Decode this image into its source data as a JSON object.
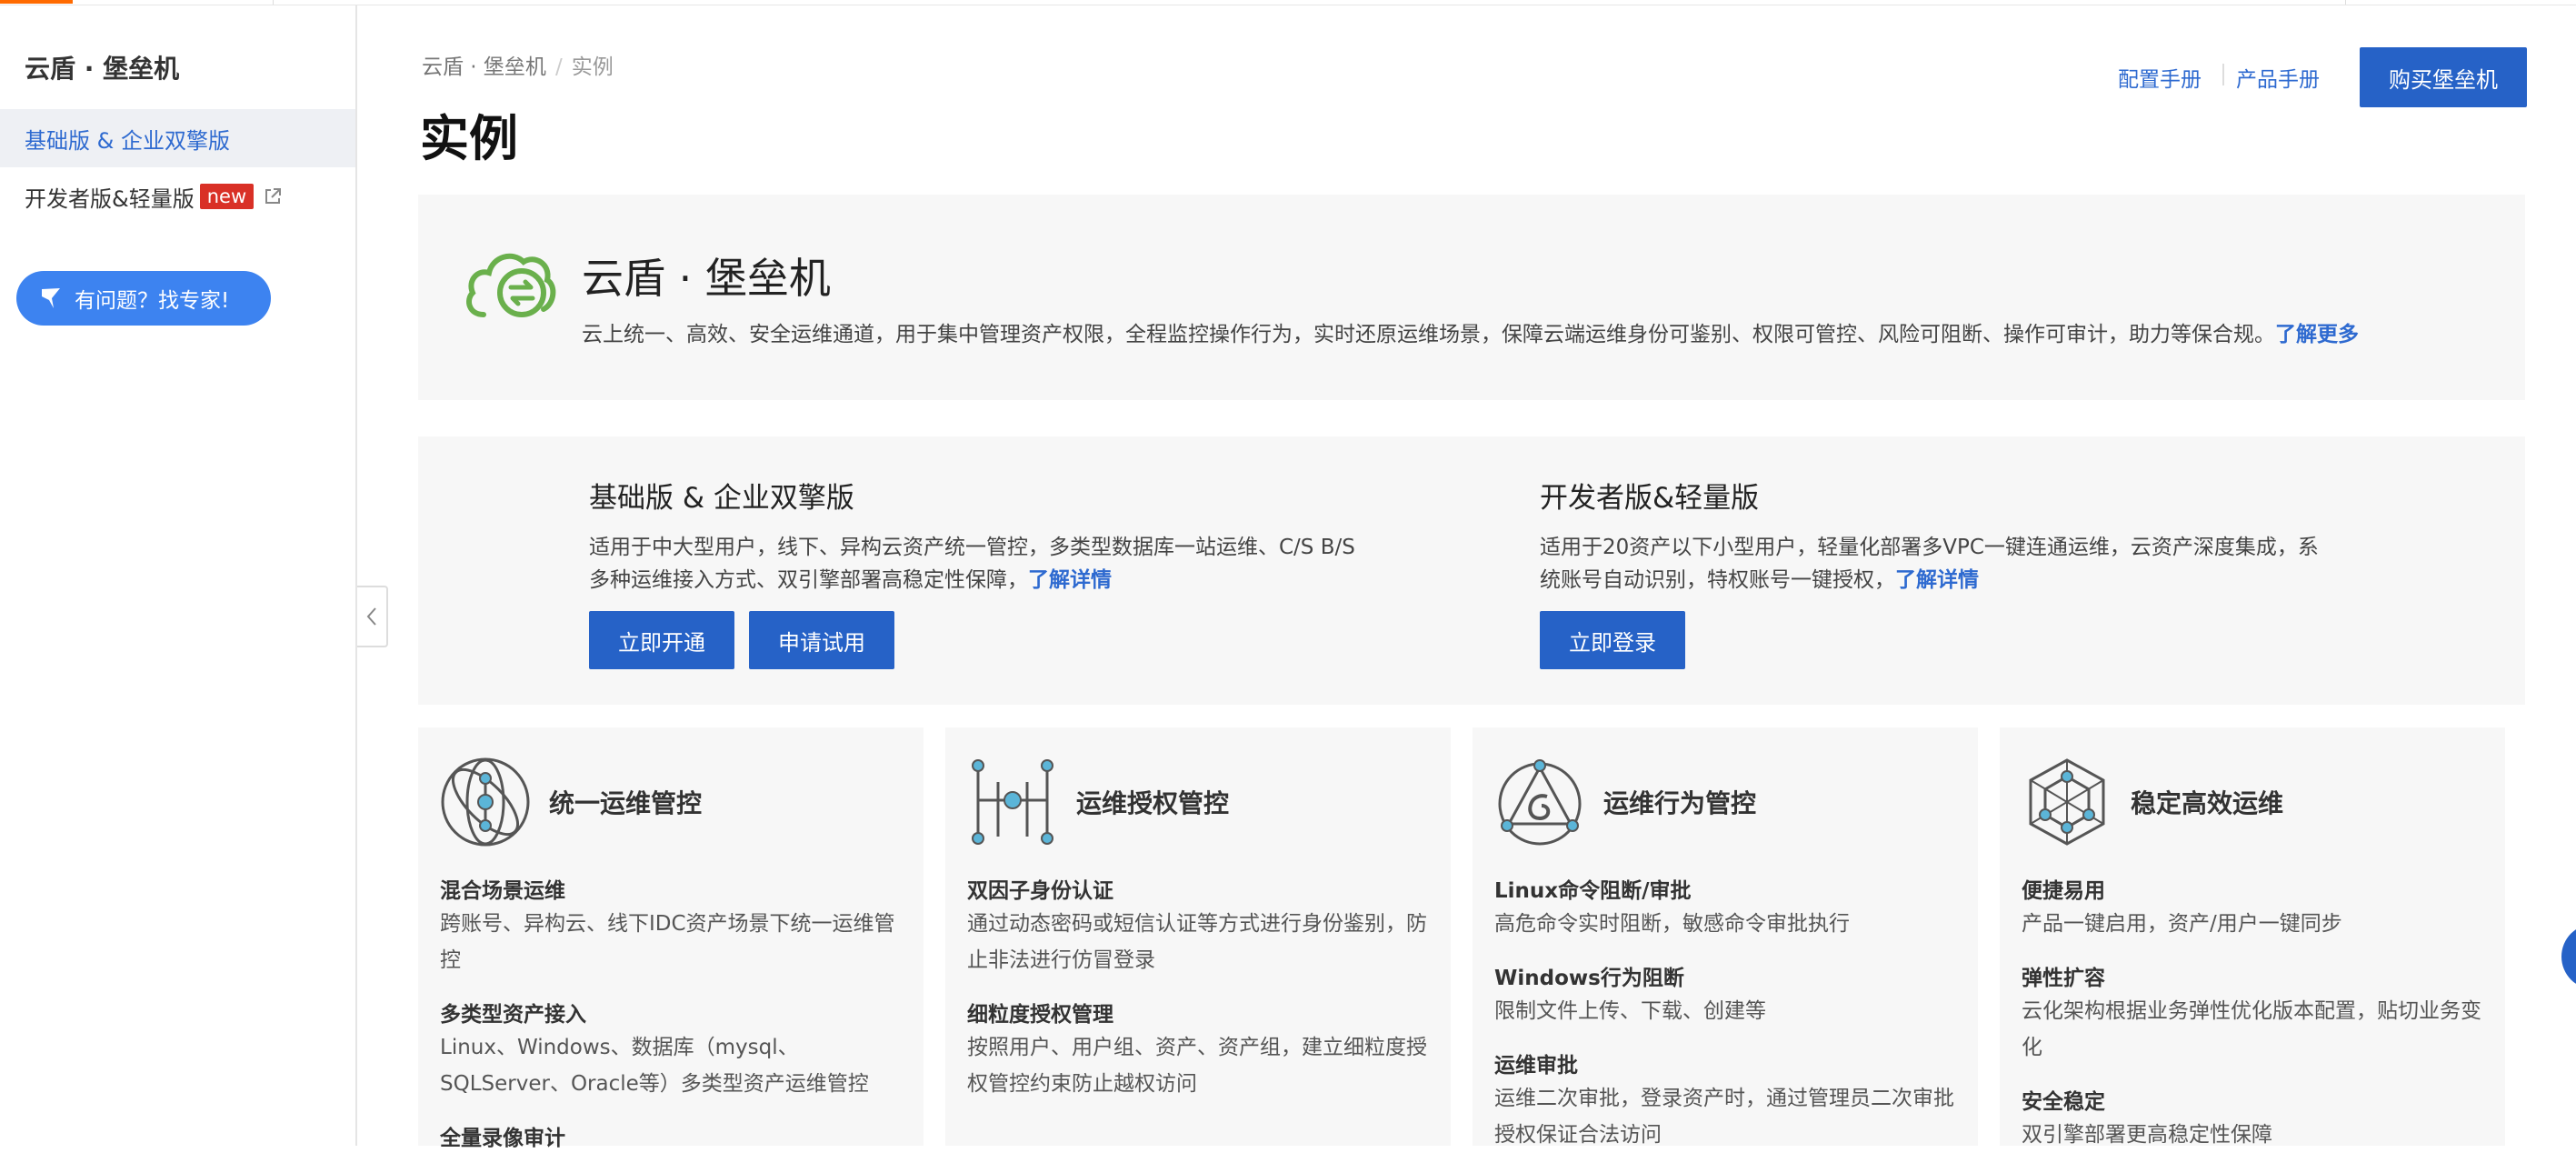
{
  "sidebar": {
    "title": "云盾 · 堡垒机",
    "items": [
      {
        "label": "基础版 & 企业双擎版"
      },
      {
        "label": "开发者版&轻量版",
        "badge": "new"
      }
    ],
    "expert_button": "有问题？找专家!"
  },
  "breadcrumb": {
    "parent": "云盾 · 堡垒机",
    "separator": "/",
    "current": "实例"
  },
  "page_title": "实例",
  "header_links": {
    "config_manual": "配置手册",
    "product_manual": "产品手册",
    "buy_button": "购买堡垒机"
  },
  "hero": {
    "title": "云盾 · 堡垒机",
    "description": "云上统一、高效、安全运维通道，用于集中管理资产权限，全程监控操作行为，实时还原运维场景，保障云端运维身份可鉴别、权限可管控、风险可阻断、操作可审计，助力等保合规。",
    "learn_more": "了解更多"
  },
  "editions": [
    {
      "title": "基础版 & 企业双擎版",
      "desc_line1": "适用于中大型用户，线下、异构云资产统一管控，多类型数据库一站运维、C/S B/S",
      "desc_line2": "多种运维接入方式、双引擎部署高稳定性保障，",
      "more": "了解详情",
      "buttons": [
        "立即开通",
        "申请试用"
      ]
    },
    {
      "title": "开发者版&轻量版",
      "desc_line1": "适用于20资产以下小型用户，轻量化部署多VPC一键连通运维，云资产深度集成，系",
      "desc_line2": "统账号自动识别，特权账号一键授权，",
      "more": "了解详情",
      "buttons": [
        "立即登录"
      ]
    }
  ],
  "features": [
    {
      "title": "统一运维管控",
      "icon": "unified-ops-icon",
      "items": [
        {
          "name": "混合场景运维",
          "desc": "跨账号、异构云、线下IDC资产场景下统一运维管控"
        },
        {
          "name": "多类型资产接入",
          "desc": "Linux、Windows、数据库（mysql、SQLServer、Oracle等）多类型资产运维管控"
        },
        {
          "name": "全量录像审计",
          "desc": ""
        }
      ]
    },
    {
      "title": "运维授权管控",
      "icon": "authorization-icon",
      "items": [
        {
          "name": "双因子身份认证",
          "desc": "通过动态密码或短信认证等方式进行身份鉴别，防止非法进行仿冒登录"
        },
        {
          "name": "细粒度授权管理",
          "desc": "按照用户、用户组、资产、资产组，建立细粒度授权管控约束防止越权访问"
        }
      ]
    },
    {
      "title": "运维行为管控",
      "icon": "behavior-control-icon",
      "items": [
        {
          "name": "Linux命令阻断/审批",
          "desc": "高危命令实时阻断，敏感命令审批执行"
        },
        {
          "name": "Windows行为阻断",
          "desc": "限制文件上传、下载、创建等"
        },
        {
          "name": "运维审批",
          "desc": "运维二次审批，登录资产时，通过管理员二次审批授权保证合法访问"
        }
      ]
    },
    {
      "title": "稳定高效运维",
      "icon": "stable-ops-icon",
      "items": [
        {
          "name": "便捷易用",
          "desc": "产品一键启用，资产/用户一键同步"
        },
        {
          "name": "弹性扩容",
          "desc": "云化架构根据业务弹性优化版本配置，贴切业务变化"
        },
        {
          "name": "安全稳定",
          "desc": "双引擎部署更高稳定性保障"
        }
      ]
    }
  ],
  "colors": {
    "accent": "#ff6a00",
    "primary": "#2662c7",
    "link": "#2e6ad0",
    "badge": "#d93026",
    "expert": "#3d83f0",
    "logo_green": "#6ab04c"
  }
}
